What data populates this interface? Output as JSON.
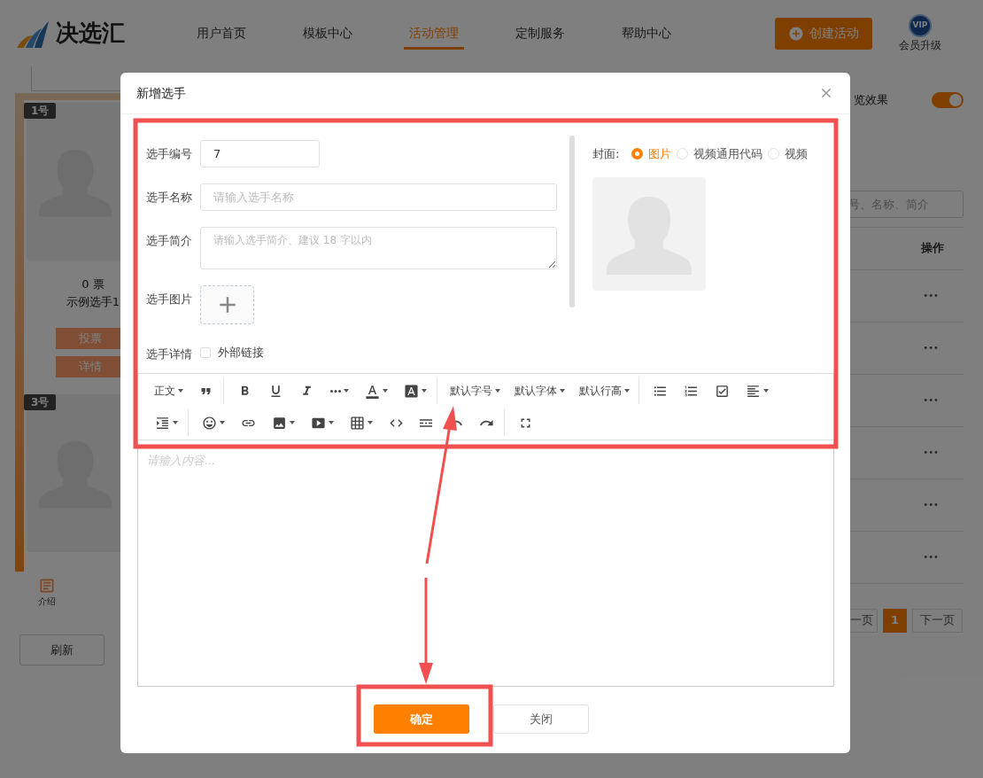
{
  "header": {
    "logo_text": "决选汇",
    "nav": [
      {
        "label": "用户首页",
        "selected": false
      },
      {
        "label": "模板中心",
        "selected": false
      },
      {
        "label": "活动管理",
        "selected": true
      },
      {
        "label": "定制服务",
        "selected": false
      },
      {
        "label": "帮助中心",
        "selected": false
      }
    ],
    "create_button": "创建活动",
    "vip_badge": "VIP",
    "vip_label": "会员升级"
  },
  "background": {
    "cards": [
      {
        "number": "1号",
        "votes": "0 票",
        "name": "示例选手1",
        "buttons": [
          "投票",
          "详情"
        ]
      },
      {
        "number": "3号"
      }
    ],
    "bottom_tab": "介绍",
    "refresh_button": "刷新",
    "preview_label": "览效果",
    "preview_on": true,
    "search_placeholder": "号、名称、简介",
    "table": {
      "column": "操作",
      "rows": [
        "•••",
        "•••",
        "•••",
        "•••",
        "•••",
        "•••"
      ]
    },
    "pagination": {
      "prev": "一页",
      "pages": [
        {
          "label": "1",
          "selected": true
        }
      ],
      "next": "下一页"
    }
  },
  "dialog": {
    "title": "新增选手",
    "fields": [
      {
        "kind": "input",
        "label": "选手编号",
        "value": "7"
      },
      {
        "kind": "input",
        "label": "选手名称",
        "placeholder": "请输入选手名称"
      },
      {
        "kind": "textarea",
        "label": "选手简介",
        "placeholder": "请输入选手简介、建议 18 字以内"
      },
      {
        "kind": "upload",
        "label": "选手图片"
      },
      {
        "kind": "checkbox",
        "label": "选手详情",
        "option": "外部链接",
        "checked": false
      }
    ],
    "cover": {
      "label": "封面:",
      "options": [
        {
          "label": "图片",
          "selected": true
        },
        {
          "label": "视频通用代码",
          "selected": false
        },
        {
          "label": "视频",
          "selected": false
        }
      ]
    },
    "toolbar": [
      [
        [
          {
            "kind": "text",
            "label": "正文",
            "dropdown": true
          },
          {
            "kind": "quote",
            "dropdown": false
          }
        ],
        [
          {
            "kind": "bold",
            "dropdown": false
          },
          {
            "kind": "underline",
            "dropdown": false
          },
          {
            "kind": "italic",
            "dropdown": false
          },
          {
            "kind": "more",
            "dropdown": true
          },
          {
            "kind": "font-color",
            "dropdown": true
          },
          {
            "kind": "back-color",
            "dropdown": true
          }
        ],
        [
          {
            "kind": "text",
            "label": "默认字号",
            "dropdown": true
          },
          {
            "kind": "text",
            "label": "默认字体",
            "dropdown": true
          },
          {
            "kind": "text",
            "label": "默认行高",
            "dropdown": true
          }
        ],
        [
          {
            "kind": "bullet-list",
            "dropdown": false
          },
          {
            "kind": "numbered-list",
            "dropdown": false
          },
          {
            "kind": "todo",
            "dropdown": false
          },
          {
            "kind": "align",
            "dropdown": true
          }
        ]
      ],
      [
        [
          {
            "kind": "indent",
            "dropdown": true
          }
        ],
        [
          {
            "kind": "emoji",
            "dropdown": true
          },
          {
            "kind": "link",
            "dropdown": false
          },
          {
            "kind": "image",
            "dropdown": true
          },
          {
            "kind": "video",
            "dropdown": true
          },
          {
            "kind": "table",
            "dropdown": true
          },
          {
            "kind": "code",
            "dropdown": false
          },
          {
            "kind": "divider",
            "dropdown": false
          },
          {
            "kind": "undo",
            "dropdown": false
          },
          {
            "kind": "redo",
            "dropdown": false
          }
        ],
        [
          {
            "kind": "fullscreen",
            "dropdown": false
          }
        ]
      ]
    ],
    "editor_placeholder": "请输入内容...",
    "confirm_button": "确定",
    "close_button": "关闭"
  }
}
